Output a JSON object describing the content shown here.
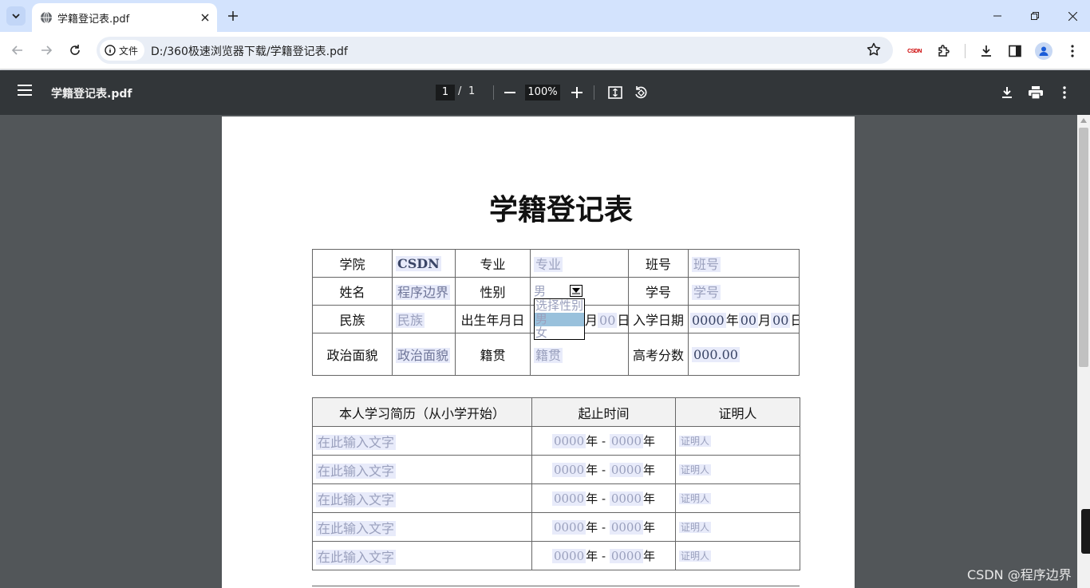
{
  "browser": {
    "tab_title": "学籍登记表.pdf",
    "chip_label": "文件",
    "url": "D:/360极速浏览器下载/学籍登记表.pdf",
    "csdn_ext": "CSDN"
  },
  "pdf_toolbar": {
    "title": "学籍登记表.pdf",
    "page_current": "1",
    "page_sep": "/",
    "page_total": "1",
    "zoom": "100%"
  },
  "document": {
    "title": "学籍登记表",
    "info": {
      "college_label": "学院",
      "college_value": "CSDN",
      "major_label": "专业",
      "major_placeholder": "专业",
      "class_label": "班号",
      "class_placeholder": "班号",
      "name_label": "姓名",
      "name_value": "程序边界",
      "gender_label": "性别",
      "gender_value": "男",
      "student_id_label": "学号",
      "student_id_placeholder": "学号",
      "ethnicity_label": "民族",
      "ethnicity_placeholder": "民族",
      "birth_label": "出生年月日",
      "birth_month_suffix": "月",
      "birth_day": "00",
      "birth_day_suffix": "日",
      "enroll_label": "入学日期",
      "enroll_year": "0000",
      "enroll_year_suffix": "年",
      "enroll_month": "00",
      "enroll_month_suffix": "月",
      "enroll_day": "00",
      "enroll_day_suffix": "日",
      "political_label": "政治面貌",
      "political_placeholder": "政治面貌",
      "native_label": "籍贯",
      "native_placeholder": "籍贯",
      "score_label": "高考分数",
      "score_value": "000.00"
    },
    "gender_dropdown": {
      "options": [
        "选择性别",
        "男",
        "女"
      ],
      "highlighted_index": 1
    },
    "history": {
      "headers": [
        "本人学习简历（从小学开始）",
        "起止时间",
        "证明人"
      ],
      "rows": [
        {
          "text": "在此输入文字",
          "start": "0000",
          "start_suffix": "年",
          "dash": "-",
          "end": "0000",
          "end_suffix": "年",
          "witness": "证明人"
        },
        {
          "text": "在此输入文字",
          "start": "0000",
          "start_suffix": "年",
          "dash": "-",
          "end": "0000",
          "end_suffix": "年",
          "witness": "证明人"
        },
        {
          "text": "在此输入文字",
          "start": "0000",
          "start_suffix": "年",
          "dash": "-",
          "end": "0000",
          "end_suffix": "年",
          "witness": "证明人"
        },
        {
          "text": "在此输入文字",
          "start": "0000",
          "start_suffix": "年",
          "dash": "-",
          "end": "0000",
          "end_suffix": "年",
          "witness": "证明人"
        },
        {
          "text": "在此输入文字",
          "start": "0000",
          "start_suffix": "年",
          "dash": "-",
          "end": "0000",
          "end_suffix": "年",
          "witness": "证明人"
        }
      ]
    }
  },
  "watermark": "CSDN @程序边界",
  "colors": {
    "tabstrip": "#d3e3fd",
    "pdf_toolbar": "#323639",
    "viewer_bg": "#525659",
    "placeholder": "#9aa0bd"
  },
  "icons": [
    "tab-search-icon",
    "globe-icon",
    "close-icon",
    "plus-icon",
    "minimize-icon",
    "restore-icon",
    "back-icon",
    "forward-icon",
    "reload-icon",
    "info-icon",
    "star-icon",
    "extensions-icon",
    "download-icon",
    "sidepanel-icon",
    "profile-icon",
    "menu-icon",
    "hamburger-icon",
    "zoom-out-icon",
    "zoom-in-icon",
    "fit-page-icon",
    "rotate-icon",
    "print-icon",
    "more-icon"
  ]
}
